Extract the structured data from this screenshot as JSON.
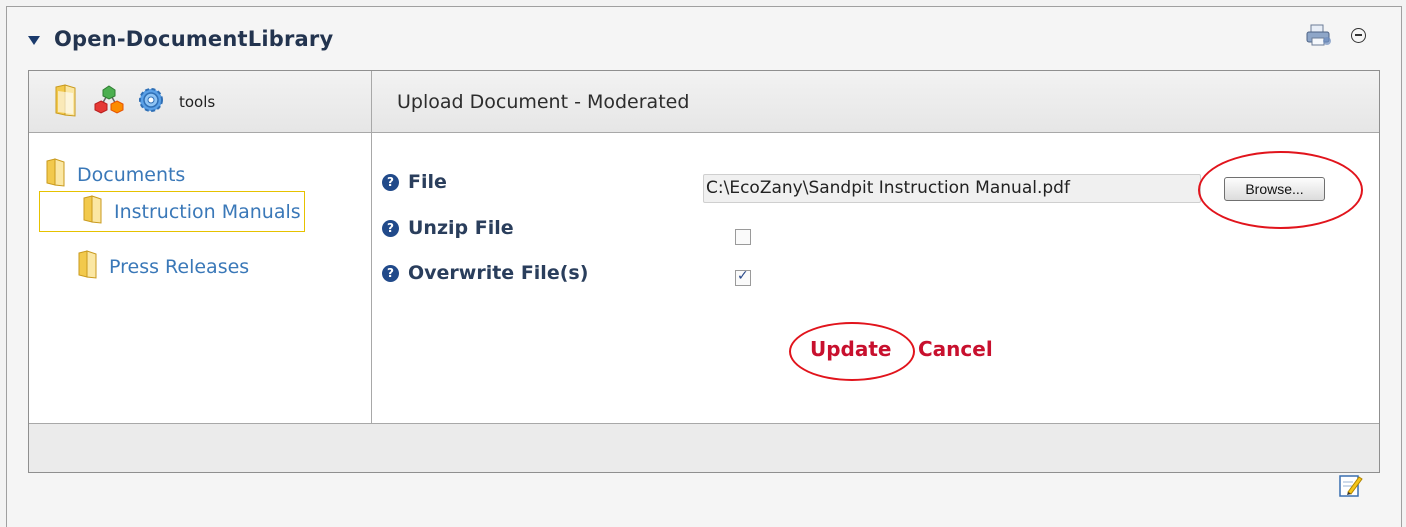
{
  "module": {
    "title": "Open-DocumentLibrary"
  },
  "toolbar": {
    "icons": [
      "folder-icon",
      "sitemap-icon",
      "settings-gear-icon"
    ],
    "tools_label": "tools"
  },
  "tree": {
    "items": [
      {
        "label": "Documents",
        "level": 0,
        "selected": false
      },
      {
        "label": "Instruction Manuals",
        "level": 1,
        "selected": true
      },
      {
        "label": "Press Releases",
        "level": 1,
        "selected": false
      }
    ]
  },
  "form": {
    "heading": "Upload Document  - Moderated",
    "file_label": "File",
    "file_value": "C:\\EcoZany\\Sandpit Instruction Manual.pdf",
    "browse_label": "Browse...",
    "unzip_label": "Unzip File",
    "unzip_checked": false,
    "overwrite_label": "Overwrite File(s)",
    "overwrite_checked": true,
    "update_label": "Update",
    "cancel_label": "Cancel"
  },
  "colors": {
    "link": "#3a78b8",
    "action": "#c8102e",
    "highlight_circle": "#e1141c",
    "selected_border": "#e6c200"
  }
}
